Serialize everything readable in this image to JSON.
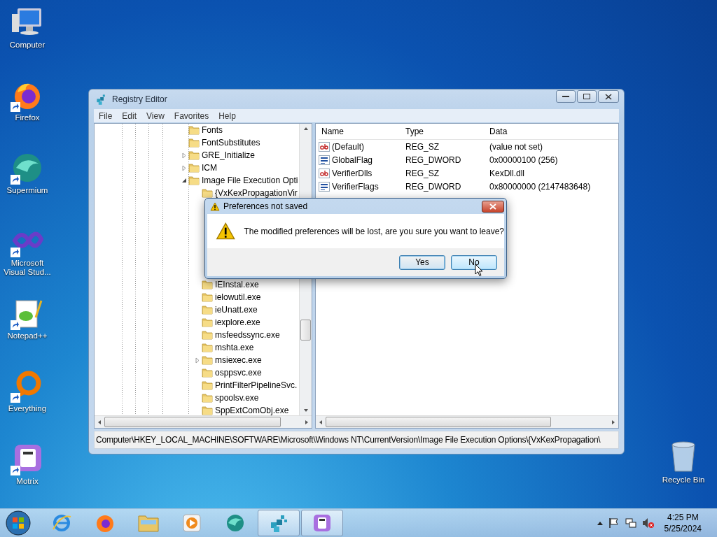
{
  "desktop_icons": [
    {
      "label": "Computer",
      "kind": "computer",
      "shortcut": false
    },
    {
      "label": "Firefox",
      "kind": "firefox",
      "shortcut": true
    },
    {
      "label": "Supermium",
      "kind": "supermium",
      "shortcut": true
    },
    {
      "label": "Microsoft Visual Stud...",
      "kind": "vs",
      "shortcut": true
    },
    {
      "label": "Notepad++",
      "kind": "notepad",
      "shortcut": true
    },
    {
      "label": "Everything",
      "kind": "everything",
      "shortcut": true
    },
    {
      "label": "Motrix",
      "kind": "motrix",
      "shortcut": true
    }
  ],
  "recycle_bin": {
    "label": "Recycle Bin"
  },
  "window": {
    "title": "Registry Editor",
    "menu": [
      "File",
      "Edit",
      "View",
      "Favorites",
      "Help"
    ],
    "tree": [
      {
        "label": "Fonts"
      },
      {
        "label": "FontSubstitutes"
      },
      {
        "label": "GRE_Initialize",
        "expanded": false
      },
      {
        "label": "ICM",
        "expanded": false
      },
      {
        "label": "Image File Execution Opti",
        "expanded": true,
        "children": [
          {
            "label": "{VxKexPropagationVir"
          },
          {
            "label": "IEInstal.exe"
          },
          {
            "label": "ielowutil.exe"
          },
          {
            "label": "ieUnatt.exe"
          },
          {
            "label": "iexplore.exe"
          },
          {
            "label": "msfeedssync.exe"
          },
          {
            "label": "mshta.exe"
          },
          {
            "label": "msiexec.exe",
            "expanded": false
          },
          {
            "label": "osppsvc.exe"
          },
          {
            "label": "PrintFilterPipelineSvc."
          },
          {
            "label": "spoolsv.exe"
          },
          {
            "label": "SppExtComObj.exe"
          }
        ]
      }
    ],
    "values": {
      "columns": [
        "Name",
        "Type",
        "Data"
      ],
      "rows": [
        {
          "name": "(Default)",
          "type": "REG_SZ",
          "data": "(value not set)",
          "kind": "string"
        },
        {
          "name": "GlobalFlag",
          "type": "REG_DWORD",
          "data": "0x00000100 (256)",
          "kind": "binary"
        },
        {
          "name": "VerifierDlls",
          "type": "REG_SZ",
          "data": "KexDll.dll",
          "kind": "string"
        },
        {
          "name": "VerifierFlags",
          "type": "REG_DWORD",
          "data": "0x80000000 (2147483648)",
          "kind": "binary"
        }
      ]
    },
    "status_bar": "Computer\\HKEY_LOCAL_MACHINE\\SOFTWARE\\Microsoft\\Windows NT\\CurrentVersion\\Image File Execution Options\\{VxKexPropagation\\"
  },
  "dialog": {
    "title": "Preferences not saved",
    "message": "The modified preferences will be lost, are you sure you want to leave?",
    "buttons": [
      {
        "label": "Yes",
        "selected": false
      },
      {
        "label": "No",
        "selected": true
      }
    ]
  },
  "taskbar": {
    "items": [
      {
        "kind": "ie",
        "running": false
      },
      {
        "kind": "firefox",
        "running": false
      },
      {
        "kind": "explorer",
        "running": false
      },
      {
        "kind": "media",
        "running": false
      },
      {
        "kind": "supermium",
        "running": false
      },
      {
        "kind": "regedit",
        "running": true
      },
      {
        "kind": "motrix",
        "running": true
      }
    ],
    "time": "4:25 PM",
    "date": "5/25/2024"
  }
}
